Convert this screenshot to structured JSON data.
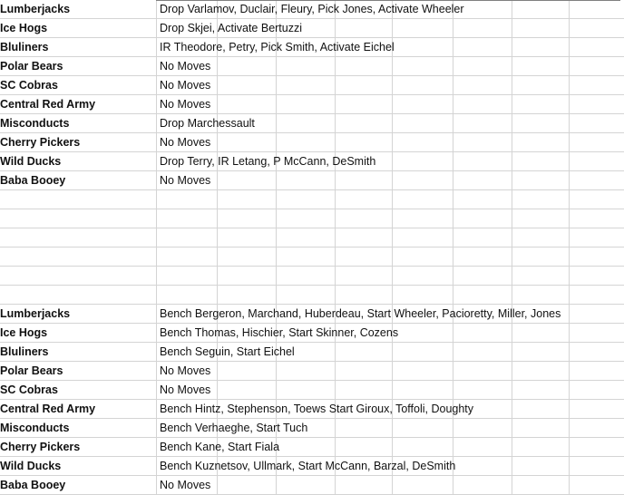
{
  "sheet": {
    "title": "Transactions Spreadsheet",
    "grid_color": "#d4d4d4",
    "text_color": "#111111",
    "background": "#ffffff",
    "columns": 9,
    "rows": 26
  },
  "sections": [
    {
      "name": "roster-moves",
      "rows": [
        {
          "team": "Lumberjacks",
          "moves": "Drop Varlamov, Duclair, Fleury, Pick Jones, Activate Wheeler"
        },
        {
          "team": "Ice Hogs",
          "moves": "Drop Skjei, Activate Bertuzzi"
        },
        {
          "team": "Bluliners",
          "moves": "IR Theodore, Petry, Pick Smith, Activate Eichel"
        },
        {
          "team": "Polar Bears",
          "moves": "No Moves"
        },
        {
          "team": "SC Cobras",
          "moves": "No Moves"
        },
        {
          "team": "Central Red Army",
          "moves": "No Moves"
        },
        {
          "team": "Misconducts",
          "moves": "Drop Marchessault"
        },
        {
          "team": "Cherry Pickers",
          "moves": "No Moves"
        },
        {
          "team": "Wild Ducks",
          "moves": "Drop Terry, IR Letang, P McCann, DeSmith"
        },
        {
          "team": "Baba Booey",
          "moves": "No Moves"
        }
      ]
    },
    {
      "name": "lineup-moves",
      "rows": [
        {
          "team": "Lumberjacks",
          "moves": "Bench Bergeron, Marchand, Huberdeau, Start Wheeler, Pacioretty, Miller, Jones"
        },
        {
          "team": "Ice Hogs",
          "moves": "Bench Thomas, Hischier, Start Skinner, Cozens"
        },
        {
          "team": "Bluliners",
          "moves": "Bench Seguin, Start Eichel"
        },
        {
          "team": "Polar Bears",
          "moves": "No Moves"
        },
        {
          "team": "SC Cobras",
          "moves": "No Moves"
        },
        {
          "team": "Central Red Army",
          "moves": "Bench Hintz, Stephenson, Toews Start Giroux, Toffoli, Doughty"
        },
        {
          "team": "Misconducts",
          "moves": "Bench Verhaeghe, Start Tuch"
        },
        {
          "team": "Cherry Pickers",
          "moves": "Bench Kane, Start Fiala"
        },
        {
          "team": "Wild Ducks",
          "moves": "Bench Kuznetsov, Ullmark, Start McCann, Barzal, DeSmith"
        },
        {
          "team": "Baba Booey",
          "moves": "No Moves"
        }
      ]
    }
  ],
  "blank_rows_between": 6
}
